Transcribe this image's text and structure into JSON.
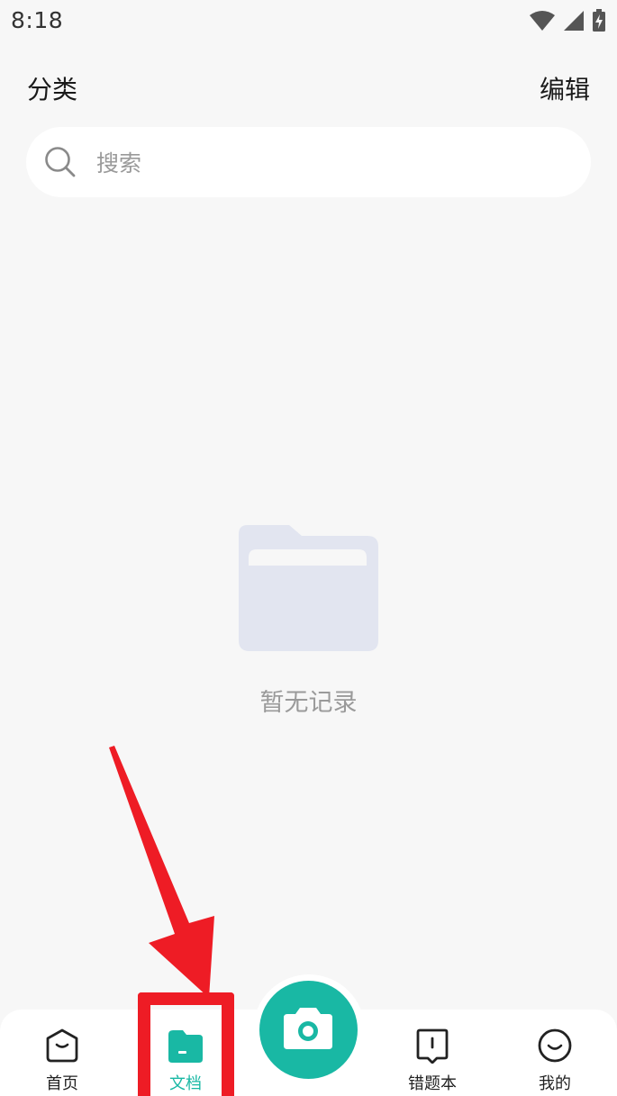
{
  "status_bar": {
    "time": "8:18",
    "icons": [
      "wifi-icon",
      "signal-icon",
      "battery-charging-icon"
    ]
  },
  "header": {
    "title": "分类",
    "edit_label": "编辑"
  },
  "search": {
    "placeholder": "搜索",
    "value": ""
  },
  "empty_state": {
    "icon": "folder-icon",
    "text": "暂无记录"
  },
  "bottom_nav": {
    "items": [
      {
        "label": "首页",
        "icon": "home-icon",
        "active": false
      },
      {
        "label": "文档",
        "icon": "document-folder-icon",
        "active": true
      },
      {
        "label": "错题本",
        "icon": "mistake-book-icon",
        "active": false
      },
      {
        "label": "我的",
        "icon": "profile-smile-icon",
        "active": false
      }
    ],
    "center_action": {
      "icon": "camera-icon"
    }
  },
  "colors": {
    "accent": "#19b8a4",
    "background": "#f7f7f7",
    "annotation": "#ee1c25",
    "placeholder": "#9a9a9a",
    "empty_icon": "#e2e5f0"
  }
}
